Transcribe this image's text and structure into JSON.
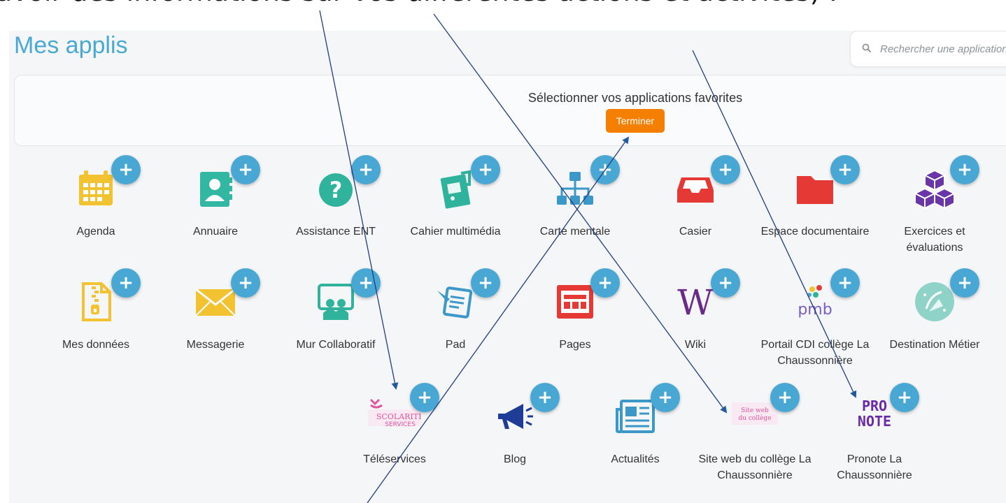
{
  "caption": "avoir des informations sur vos différentes actions et activités) :",
  "page_title": "Mes applis",
  "search": {
    "placeholder": "Rechercher une application"
  },
  "favorites": {
    "prompt": "Sélectionner vos applications favorites",
    "finish_label": "Terminer"
  },
  "plus_symbol": "+",
  "apps": [
    {
      "name": "Agenda",
      "icon": "calendar-icon",
      "color": "#f2c230"
    },
    {
      "name": "Annuaire",
      "icon": "contact-card-icon",
      "color": "#31b7a2"
    },
    {
      "name": "Assistance ENT",
      "icon": "help-circle-icon",
      "color": "#2fb39c"
    },
    {
      "name": "Cahier multimédia",
      "icon": "multimedia-notebook-icon",
      "color": "#2fb39c"
    },
    {
      "name": "Carte mentale",
      "icon": "sitemap-icon",
      "color": "#3b98c9"
    },
    {
      "name": "Casier",
      "icon": "inbox-tray-icon",
      "color": "#e53935"
    },
    {
      "name": "Espace documentaire",
      "icon": "folder-icon",
      "color": "#e53935"
    },
    {
      "name": "Exercices et évaluations",
      "icon": "cubes-icon",
      "color": "#6a35a8"
    },
    {
      "name": "Mes données",
      "icon": "zip-file-icon",
      "color": "#f2c230"
    },
    {
      "name": "Messagerie",
      "icon": "envelope-icon",
      "color": "#f2c230"
    },
    {
      "name": "Mur Collaboratif",
      "icon": "collaborative-wall-icon",
      "color": "#2fb39c"
    },
    {
      "name": "Pad",
      "icon": "pad-icon",
      "color": "#3b98c9"
    },
    {
      "name": "Pages",
      "icon": "pages-icon",
      "color": "#e53935"
    },
    {
      "name": "Wiki",
      "icon": "wiki-icon",
      "color": "#6a2a8a"
    },
    {
      "name": "Portail CDI collège La Chaussonnière",
      "icon": "pmb-logo-icon",
      "color": "#7a5dc7"
    },
    {
      "name": "Destination Métier",
      "icon": "destination-metier-icon",
      "color": "#8fd3c8"
    },
    {
      "name": "Téléservices",
      "icon": "scolarite-services-logo-icon",
      "color": "#e0559e"
    },
    {
      "name": "Blog",
      "icon": "megaphone-icon",
      "color": "#1f3d96"
    },
    {
      "name": "Actualités",
      "icon": "newspaper-icon",
      "color": "#3b98c9"
    },
    {
      "name": "Site web du collège La Chaussonnière",
      "icon": "college-website-logo-icon",
      "color": "#e0559e"
    },
    {
      "name": "Pronote La Chaussonnière",
      "icon": "pronote-logo-icon",
      "color": "#6a2aa8"
    }
  ],
  "logo_text": {
    "pmb": "pmb",
    "scolarite": "SCOLARITÉ",
    "services": "SERVICES",
    "site_web_1": "Site web",
    "site_web_2": "du collège",
    "pronote_1": "PRO",
    "pronote_2": "NOTE",
    "wiki": "W"
  },
  "annotation_color": "#1f3d80"
}
